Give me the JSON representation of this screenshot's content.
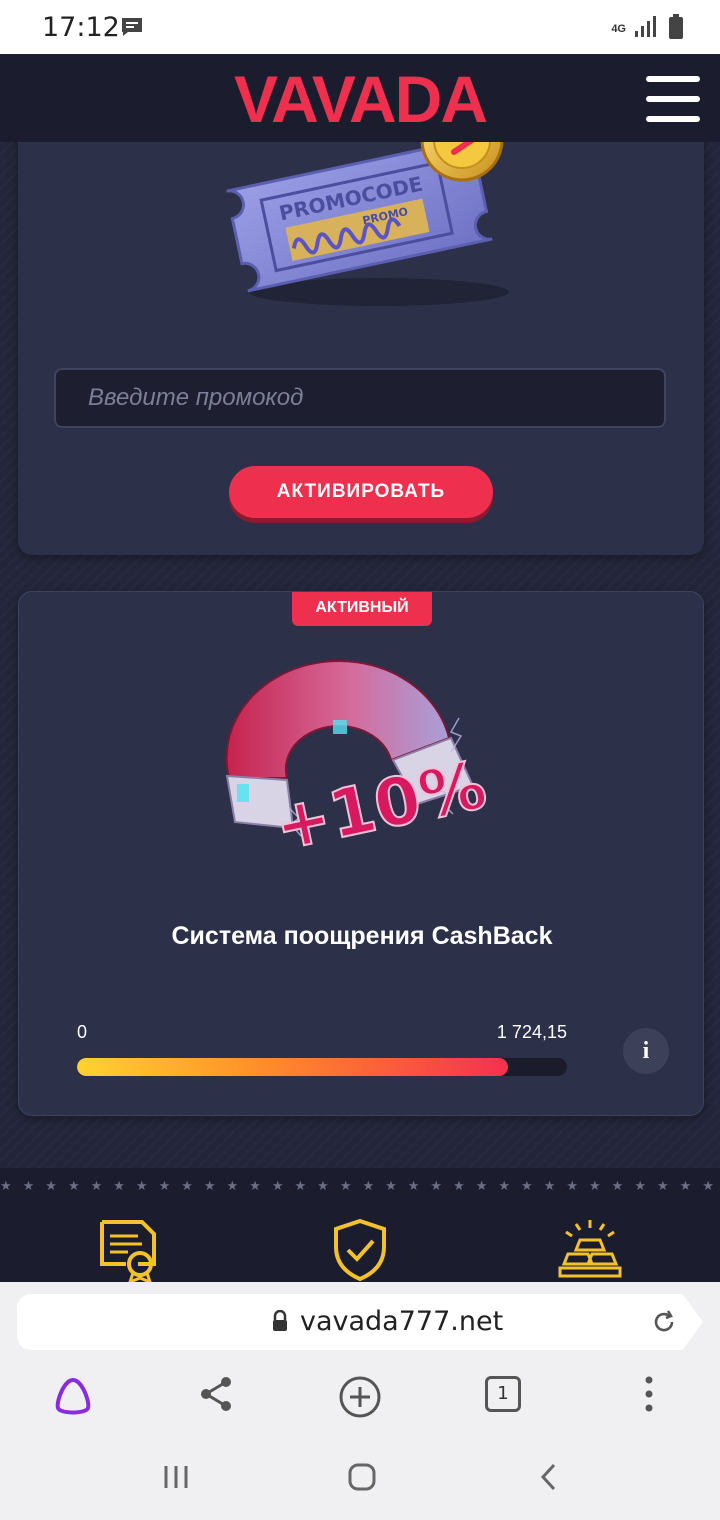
{
  "status_bar": {
    "time": "17:12",
    "network": "4G",
    "icons": [
      "message-icon",
      "signal-icon",
      "battery-icon"
    ]
  },
  "header": {
    "logo_text": "VAVADA",
    "menu_icon": "hamburger-menu-icon"
  },
  "promo": {
    "ticket_label": "PROMOCODE",
    "ticket_sublabel": "PROMO",
    "input_placeholder": "Введите промокод",
    "activate_label": "АКТИВИРОВАТЬ"
  },
  "cashback": {
    "badge": "АКТИВНЫЙ",
    "graphic_text": "+10%",
    "title": "Система поощрения CashBack",
    "progress_min": "0",
    "progress_max": "1 724,15",
    "progress_fraction": 0.88,
    "info_label": "i"
  },
  "footer": {
    "icons": [
      "license-certificate-icon",
      "security-shield-icon",
      "gold-bars-icon"
    ]
  },
  "browser": {
    "url": "vavada777.net",
    "tab_count": "1",
    "toolbar_icons": [
      "alice-assistant-icon",
      "share-icon",
      "new-tab-icon",
      "tabs-icon",
      "more-icon"
    ]
  },
  "colors": {
    "brand_red": "#ee2f4e",
    "header_bg": "#1b1d2e",
    "card_bg": "#2c3049",
    "footer_gold": "#f3c22b",
    "assistant_purple": "#8a2be2"
  }
}
